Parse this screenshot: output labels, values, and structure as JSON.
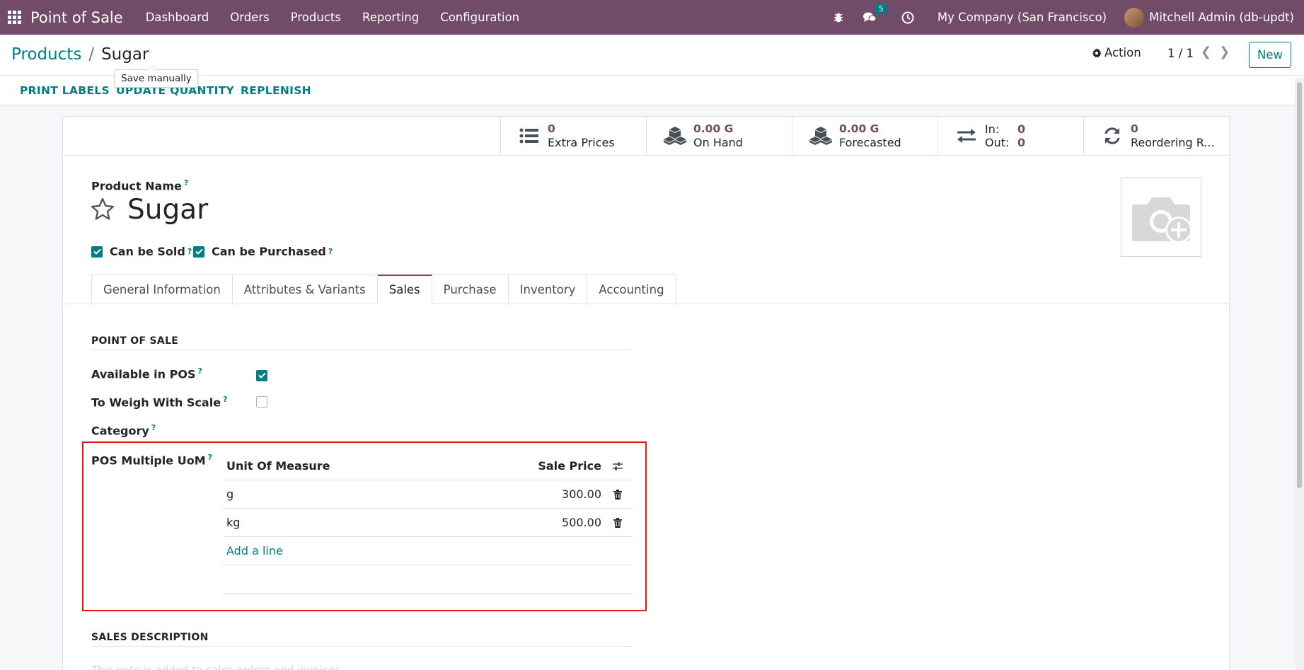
{
  "navbar": {
    "app_title": "Point of Sale",
    "menus": [
      "Dashboard",
      "Orders",
      "Products",
      "Reporting",
      "Configuration"
    ],
    "messages_badge": "5",
    "company": "My Company (San Francisco)",
    "user": "Mitchell Admin (db-updt)"
  },
  "breadcrumb": {
    "parent": "Products",
    "separator": "/",
    "current": "Sugar"
  },
  "tooltip": "Save manually",
  "control": {
    "action_label": "Action",
    "pager": "1 / 1",
    "new_label": "New"
  },
  "header_buttons": {
    "print_labels": "PRINT LABELS",
    "update_quantity": "UPDATE QUANTITY",
    "replenish": "REPLENISH"
  },
  "stats": {
    "extra_prices": {
      "value": "0",
      "label": "Extra Prices"
    },
    "on_hand": {
      "value": "0.00 G",
      "label": "On Hand"
    },
    "forecasted": {
      "value": "0.00 G",
      "label": "Forecasted"
    },
    "in_out": {
      "in_label": "In:",
      "in_value": "0",
      "out_label": "Out:",
      "out_value": "0"
    },
    "reordering": {
      "value": "0",
      "label": "Reordering R..."
    }
  },
  "form": {
    "product_name_label": "Product Name",
    "help_mark": "?",
    "product_name": "Sugar",
    "can_be_sold": "Can be Sold",
    "can_be_purchased": "Can be Purchased",
    "tabs": [
      "General Information",
      "Attributes & Variants",
      "Sales",
      "Purchase",
      "Inventory",
      "Accounting"
    ],
    "active_tab": "Sales",
    "pos_section": "POINT OF SALE",
    "available_in_pos": "Available in POS",
    "to_weigh": "To Weigh With Scale",
    "category": "Category",
    "pos_uom_label": "POS Multiple UoM",
    "uom_table": {
      "headers": {
        "uom": "Unit Of Measure",
        "price": "Sale Price"
      },
      "rows": [
        {
          "uom": "g",
          "price": "300.00"
        },
        {
          "uom": "kg",
          "price": "500.00"
        }
      ],
      "add_line": "Add a line"
    },
    "sales_description_section": "SALES DESCRIPTION",
    "sales_description_placeholder": "This note is added to sales orders and invoices."
  }
}
